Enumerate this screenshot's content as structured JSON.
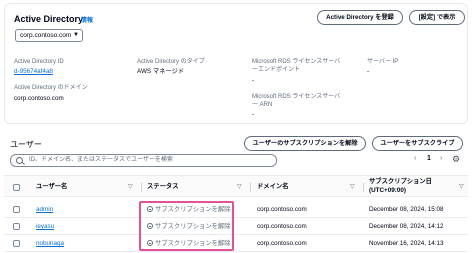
{
  "header": {
    "title": "Active Directory",
    "info": "情報",
    "register_button": "Active Directory を登録",
    "settings_button": "[設定] で表示",
    "domain_select": "corp.contoso.com"
  },
  "details": {
    "id_label": "Active Directory ID",
    "id_value": "d-95674af4a8",
    "domain_label": "Active Directory のドメイン",
    "domain_value": "corp.contoso.com",
    "type_label": "Active Directory のタイプ",
    "type_value": "AWS マネージド",
    "endpoint_label_1": "Microsoft RDS ライセンスサーバ",
    "endpoint_label_2": "ーエンドポイント",
    "endpoint_value": "-",
    "arn_label_1": "Microsoft RDS ライセンスサーバ",
    "arn_label_2": "ー ARN",
    "arn_value": "-",
    "server_ip_label": "サーバー IP",
    "server_ip_value": "-"
  },
  "users": {
    "title": "ユーザー",
    "unsubscribe_button": "ユーザーのサブスクリプションを解除",
    "subscribe_button": "ユーザーをサブスクライブ",
    "search_placeholder": "ID、ドメイン名、またはステータスでユーザーを検索",
    "page_number": "1",
    "prev_icon": "‹",
    "next_icon": "›",
    "columns": {
      "username": "ユーザー名",
      "status": "ステータス",
      "domain": "ドメイン名",
      "subscription_date_1": "サブスクリプション日",
      "subscription_date_2": "(UTC+09:00)"
    },
    "rows": [
      {
        "username": "admin",
        "status": "サブスクリプションを解除",
        "domain": "corp.contoso.com",
        "date": "December 08, 2024, 15:08"
      },
      {
        "username": "ieyasu",
        "status": "サブスクリプションを解除",
        "domain": "corp.contoso.com",
        "date": "December 08, 2024, 14:12"
      },
      {
        "username": "nobunaga",
        "status": "サブスクリプションを解除",
        "domain": "corp.contoso.com",
        "date": "November 16, 2024, 14:13"
      }
    ]
  },
  "colors": {
    "link": "#0972d3",
    "highlight": "#e0539a"
  }
}
